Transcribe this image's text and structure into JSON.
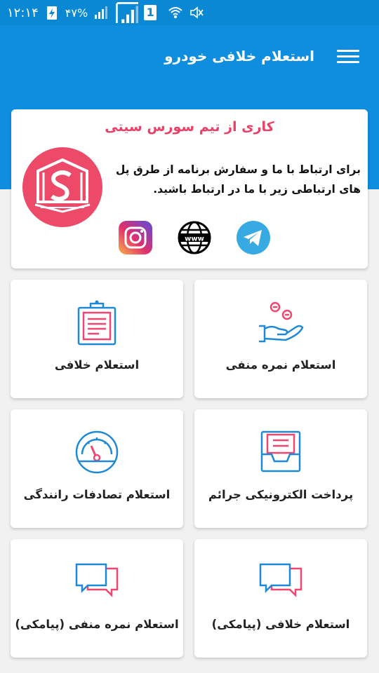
{
  "status_bar": {
    "time": "۱۲:۱۴",
    "battery": "۴۷%",
    "sim_label": "1"
  },
  "app_bar": {
    "title": "استعلام خلافی خودرو"
  },
  "contact_card": {
    "title": "کاری از تیم سورس سیتی",
    "body": "برای ارتباط با ما و سفارش برنامه از طرق پل های ارتباطی زیر با ما در ارتباط باشید.",
    "links": [
      {
        "name": "telegram",
        "icon": "telegram-icon"
      },
      {
        "name": "website",
        "icon": "www-icon"
      },
      {
        "name": "instagram",
        "icon": "instagram-icon"
      }
    ]
  },
  "tiles": [
    {
      "label": "استعلام نمره منفی",
      "icon": "hand-coins-icon"
    },
    {
      "label": "استعلام خلافی",
      "icon": "clipboard-icon"
    },
    {
      "label": "پرداخت الکترونیکی جرائم",
      "icon": "inbox-tray-icon"
    },
    {
      "label": "استعلام تصادفات رانندگی",
      "icon": "gauge-icon"
    },
    {
      "label": "استعلام خلافی (پیامکی)",
      "icon": "chat-bubbles-icon"
    },
    {
      "label": "استعلام نمره منفی (پیامکی)",
      "icon": "chat-bubbles-icon"
    }
  ],
  "colors": {
    "primary": "#0f8ee0",
    "status": "#0a88d3",
    "accent": "#ec3f66",
    "icon_blue": "#1e8ad6",
    "icon_red": "#ef4770"
  }
}
